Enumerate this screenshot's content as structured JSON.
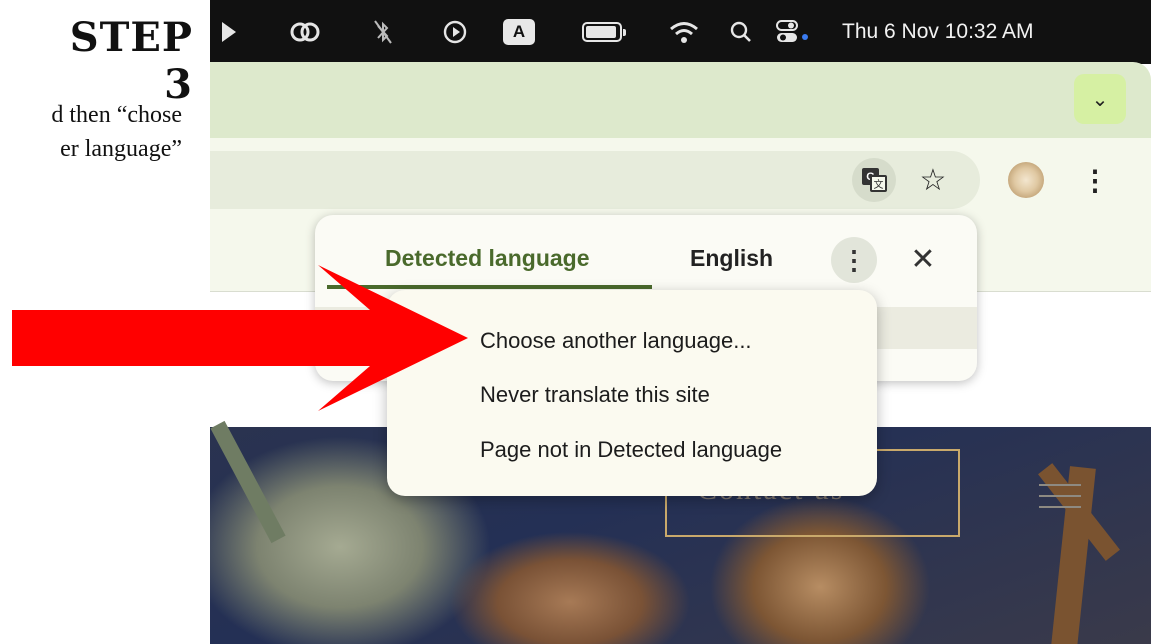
{
  "step": {
    "title": "STEP 3",
    "line1": "d then “chose",
    "line2": "er language”"
  },
  "menubar": {
    "clock": "Thu 6 Nov  10:32 AM",
    "input_source": "A",
    "icons": [
      "chevron-right-icon",
      "creative-cloud-icon",
      "bluetooth-off-icon",
      "play-icon",
      "input-source-icon",
      "battery-icon",
      "wifi-icon",
      "search-icon",
      "control-center-icon"
    ]
  },
  "browser": {
    "tab_chevron": "⌄",
    "toolbar_icons": [
      "translate-icon",
      "star-icon",
      "avatar",
      "more-icon"
    ]
  },
  "translate_bubble": {
    "tab_detected": "Detected language",
    "tab_english": "English",
    "active_tab": "Detected language",
    "accent_color": "#4a6a2c"
  },
  "options_menu": {
    "items": [
      "Choose another language...",
      "Never translate this site",
      "Page not in Detected language"
    ]
  },
  "page": {
    "contact_text": "Contact us"
  },
  "colors": {
    "arrow": "#ff0000",
    "chrome_top": "#dde9cc",
    "tab_chevron_bg": "#d6f0a3"
  }
}
